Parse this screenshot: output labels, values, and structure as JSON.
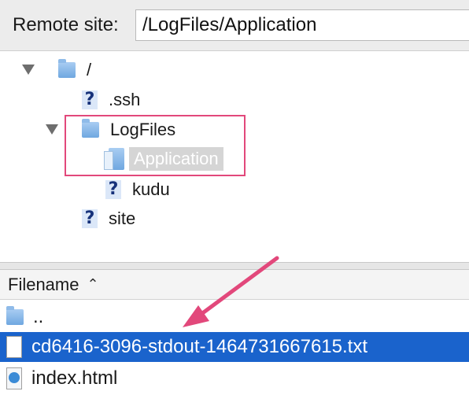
{
  "remote_site": {
    "label": "Remote site:",
    "path": "/LogFiles/Application"
  },
  "tree": {
    "items": [
      {
        "label": "/",
        "icon": "folder-icon"
      },
      {
        "label": ".ssh",
        "icon": "unknown-icon"
      },
      {
        "label": "LogFiles",
        "icon": "folder-icon"
      },
      {
        "label": "Application",
        "icon": "folder-open-icon"
      },
      {
        "label": "kudu",
        "icon": "unknown-icon"
      },
      {
        "label": "site",
        "icon": "unknown-icon"
      }
    ]
  },
  "file_list": {
    "header": {
      "filename": "Filename",
      "sort_icon": "chevron-up-icon"
    },
    "rows": [
      {
        "name": "..",
        "icon": "folder-icon"
      },
      {
        "name": "cd6416-3096-stdout-1464731667615.txt",
        "icon": "document-icon"
      },
      {
        "name": "index.html",
        "icon": "html-file-icon"
      }
    ]
  },
  "colors": {
    "selection": "#1a63cc",
    "annotation": "#e2487b"
  }
}
